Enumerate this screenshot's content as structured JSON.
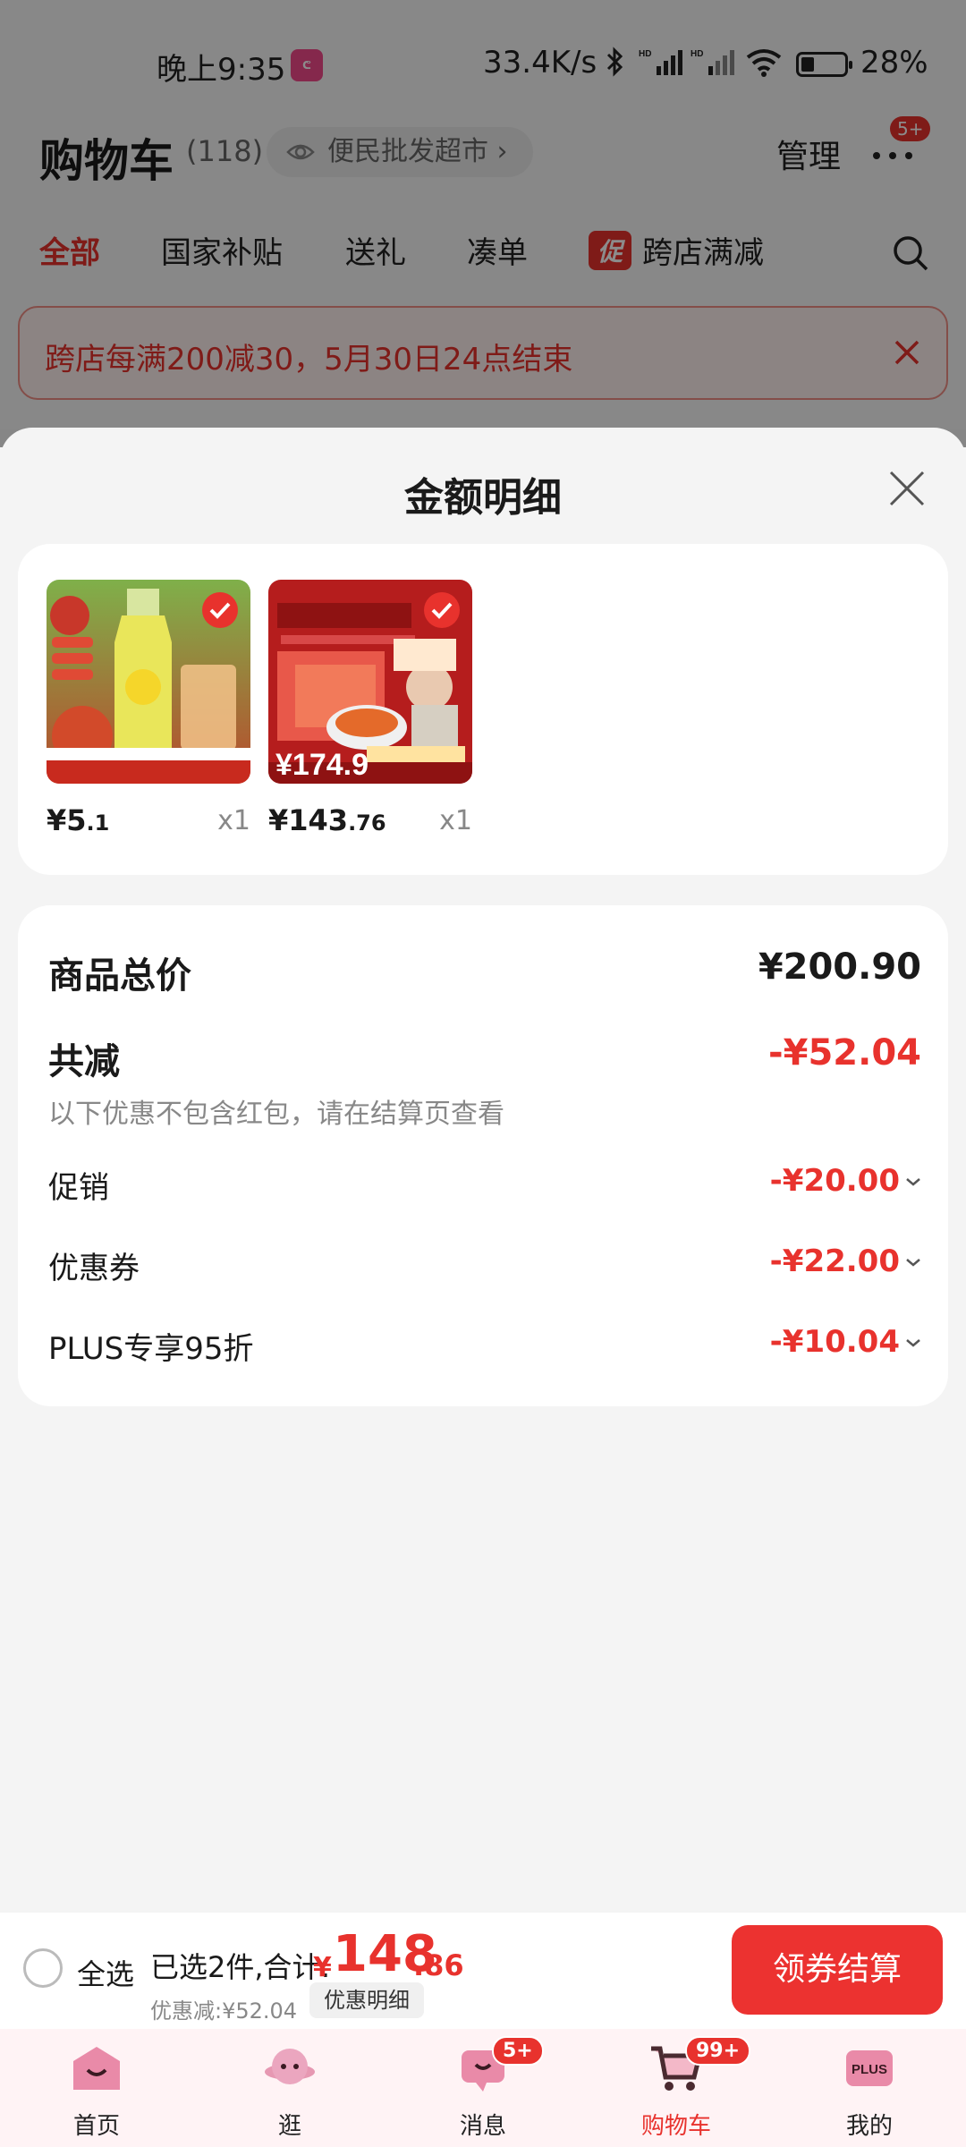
{
  "status": {
    "time": "晚上9:35",
    "app_icon_text": "bubble",
    "net_speed": "33.4K/s",
    "battery": "28%"
  },
  "header": {
    "title": "购物车",
    "count": "(118)",
    "store": "便民批发超市",
    "manage": "管理",
    "more_badge": "5+"
  },
  "tabs": [
    {
      "label": "全部",
      "active": true
    },
    {
      "label": "国家补贴"
    },
    {
      "label": "送礼"
    },
    {
      "label": "凑单"
    },
    {
      "label": "跨店满减",
      "tag": "促"
    }
  ],
  "promo_banner": "跨店每满200减30，5月30日24点结束",
  "sheet": {
    "title": "金额明细",
    "products": [
      {
        "price_int": "¥5",
        "price_dec": ".1",
        "qty": "x1",
        "image": "apple-juice-bottle"
      },
      {
        "price_int": "¥143",
        "price_dec": ".76",
        "qty": "x1",
        "image": "pasta-box-promo"
      }
    ],
    "summary": {
      "total_label": "商品总价",
      "total_value": "¥200.90",
      "reduce_label": "共减",
      "reduce_value": "-¥52.04",
      "note": "以下优惠不包含红包，请在结算页查看",
      "items": [
        {
          "label": "促销",
          "value": "-¥20.00"
        },
        {
          "label": "优惠券",
          "value": "-¥22.00"
        },
        {
          "label": "PLUS专享95折",
          "value": "-¥10.04"
        }
      ]
    }
  },
  "checkout": {
    "select_all": "全选",
    "selected_info": "已选2件,合计:",
    "yen": "¥",
    "total_int": "148",
    "total_dec": ".86",
    "discount_line": "优惠减:¥52.04",
    "discount_detail": "优惠明细",
    "button": "领券结算"
  },
  "tabbar": [
    {
      "label": "首页",
      "icon": "home-icon"
    },
    {
      "label": "逛",
      "icon": "planet-icon"
    },
    {
      "label": "消息",
      "icon": "message-icon",
      "badge": "5+"
    },
    {
      "label": "购物车",
      "icon": "cart-icon",
      "badge": "99+",
      "active": true
    },
    {
      "label": "我的",
      "icon": "plus-icon",
      "plus_text": "PLUS"
    }
  ],
  "colors": {
    "accent": "#e8322d",
    "sheet_bg": "#f4f4f4",
    "card_bg": "#ffffff"
  }
}
